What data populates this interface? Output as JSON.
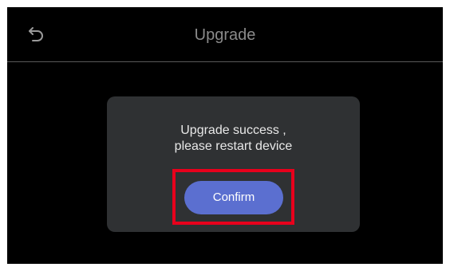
{
  "header": {
    "back_icon": "back-arrow-icon",
    "title": "Upgrade"
  },
  "dialog": {
    "message_line1": "Upgrade success ,",
    "message_line2": "please restart device",
    "confirm_label": "Confirm"
  },
  "colors": {
    "background": "#000000",
    "dialog": "#2f3133",
    "button": "#5b6fd0",
    "highlight": "#e8001c"
  }
}
